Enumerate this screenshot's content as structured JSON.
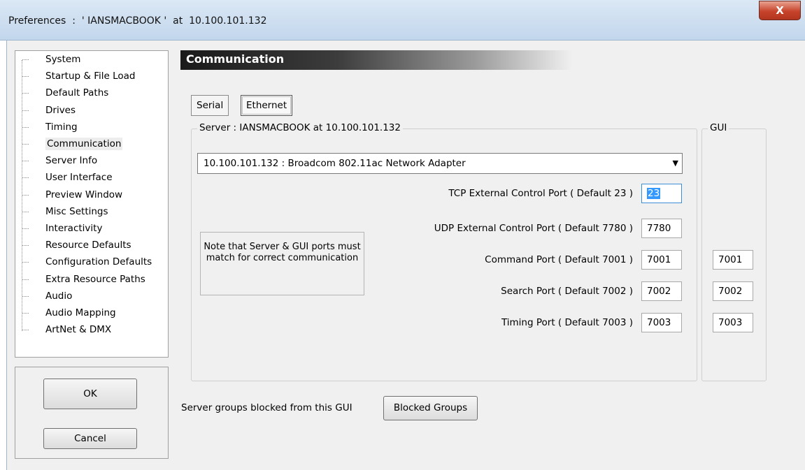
{
  "window": {
    "title": "Preferences  :  ' IANSMACBOOK '  at  10.100.101.132",
    "close_glyph": "X"
  },
  "tree": {
    "items": [
      {
        "label": "System"
      },
      {
        "label": "Startup & File Load"
      },
      {
        "label": "Default Paths"
      },
      {
        "label": "Drives"
      },
      {
        "label": "Timing"
      },
      {
        "label": "Communication",
        "selected": true
      },
      {
        "label": "Server Info"
      },
      {
        "label": "User Interface"
      },
      {
        "label": "Preview Window"
      },
      {
        "label": "Misc Settings"
      },
      {
        "label": "Interactivity"
      },
      {
        "label": "Resource Defaults"
      },
      {
        "label": "Configuration Defaults"
      },
      {
        "label": "Extra Resource Paths"
      },
      {
        "label": "Audio"
      },
      {
        "label": "Audio Mapping"
      },
      {
        "label": "ArtNet & DMX"
      }
    ]
  },
  "buttons": {
    "ok": "OK",
    "cancel": "Cancel"
  },
  "panel": {
    "header": "Communication",
    "tabs": [
      {
        "label": "Serial",
        "active": false
      },
      {
        "label": "Ethernet",
        "active": true
      }
    ],
    "server_group_label": "Server : IANSMACBOOK  at  10.100.101.132",
    "gui_group_label": "GUI",
    "adapter_select": "10.100.101.132 : Broadcom 802.11ac Network Adapter",
    "note": "Note that Server & GUI ports must match for correct communication",
    "ports": [
      {
        "label": "TCP External Control Port ( Default 23 )",
        "server": "23",
        "gui": null
      },
      {
        "label": "UDP External Control Port ( Default 7780 )",
        "server": "7780",
        "gui": null
      },
      {
        "label": "Command Port ( Default 7001 )",
        "server": "7001",
        "gui": "7001"
      },
      {
        "label": "Search Port ( Default 7002 )",
        "server": "7002",
        "gui": "7002"
      },
      {
        "label": "Timing Port ( Default 7003 )",
        "server": "7003",
        "gui": "7003"
      }
    ],
    "blocked_text": "Server groups blocked from this GUI",
    "blocked_button": "Blocked Groups"
  },
  "colors": {
    "selection": "#3399ff",
    "close_button": "#c7432b"
  }
}
